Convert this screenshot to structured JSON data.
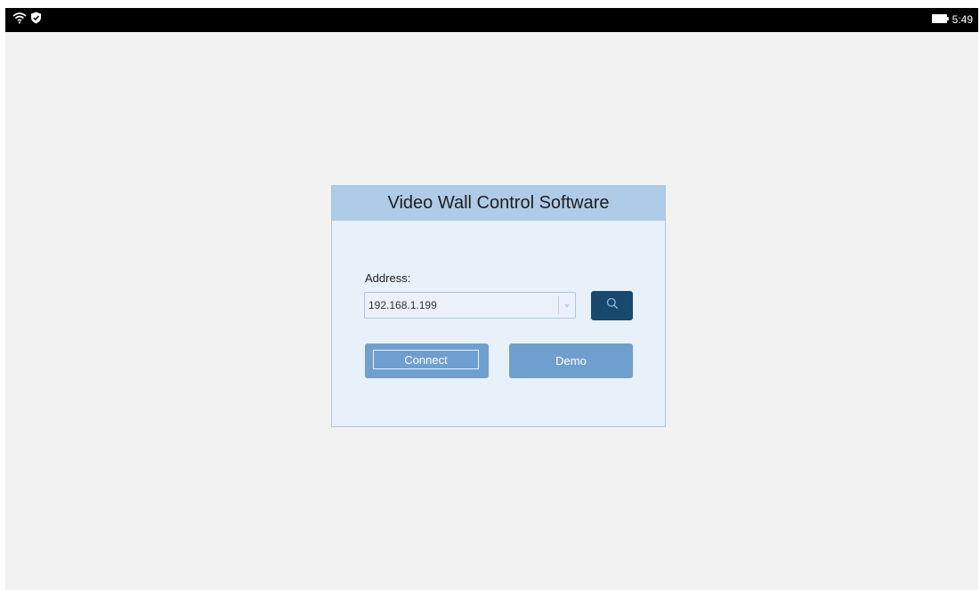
{
  "statusbar": {
    "icons_left": [
      "wifi-icon",
      "shield-check-icon"
    ],
    "battery_icon": "battery-icon",
    "time": "5:49"
  },
  "dialog": {
    "title": "Video Wall Control Software",
    "address_label": "Address:",
    "address_value": "192.168.1.199",
    "dropdown_icon": "chevron-down-icon",
    "search_icon": "search-icon",
    "connect_label": "Connect",
    "demo_label": "Demo"
  },
  "colors": {
    "background": "#f2f2f2",
    "statusbar": "#000000",
    "dialog_body": "#e8f0fa",
    "dialog_header": "#aecbe8",
    "search_button": "#17496e",
    "primary_button": "#6f9fcf"
  }
}
